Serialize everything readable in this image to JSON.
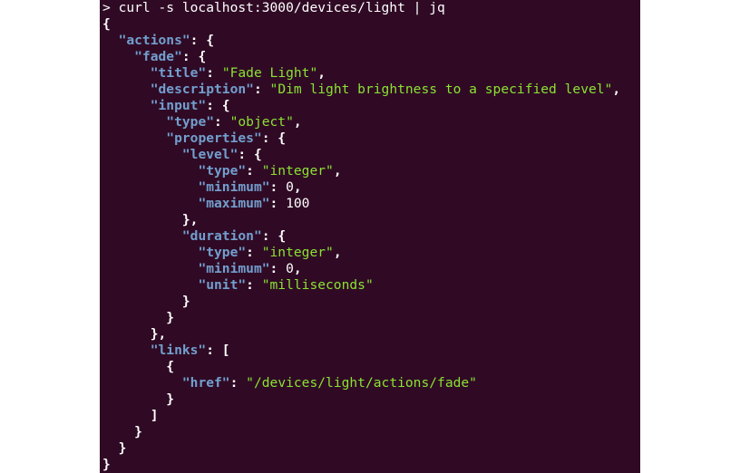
{
  "window": {
    "background": "#300a24"
  },
  "colors": {
    "key": "#729fcf",
    "string": "#8ae234",
    "text": "#ffffff"
  },
  "terminal": {
    "lines": [
      [
        {
          "t": "cmd",
          "v": "> curl -s localhost:3000/devices/light | jq"
        }
      ],
      [
        {
          "t": "punct",
          "v": "{"
        }
      ],
      [
        {
          "t": "punct",
          "v": "  "
        },
        {
          "t": "key",
          "v": "\"actions\""
        },
        {
          "t": "punct",
          "v": ": {"
        }
      ],
      [
        {
          "t": "punct",
          "v": "    "
        },
        {
          "t": "key",
          "v": "\"fade\""
        },
        {
          "t": "punct",
          "v": ": {"
        }
      ],
      [
        {
          "t": "punct",
          "v": "      "
        },
        {
          "t": "key",
          "v": "\"title\""
        },
        {
          "t": "punct",
          "v": ": "
        },
        {
          "t": "str",
          "v": "\"Fade Light\""
        },
        {
          "t": "punct",
          "v": ","
        }
      ],
      [
        {
          "t": "punct",
          "v": "      "
        },
        {
          "t": "key",
          "v": "\"description\""
        },
        {
          "t": "punct",
          "v": ": "
        },
        {
          "t": "str",
          "v": "\"Dim light brightness to a specified level\""
        },
        {
          "t": "punct",
          "v": ","
        }
      ],
      [
        {
          "t": "punct",
          "v": "      "
        },
        {
          "t": "key",
          "v": "\"input\""
        },
        {
          "t": "punct",
          "v": ": {"
        }
      ],
      [
        {
          "t": "punct",
          "v": "        "
        },
        {
          "t": "key",
          "v": "\"type\""
        },
        {
          "t": "punct",
          "v": ": "
        },
        {
          "t": "str",
          "v": "\"object\""
        },
        {
          "t": "punct",
          "v": ","
        }
      ],
      [
        {
          "t": "punct",
          "v": "        "
        },
        {
          "t": "key",
          "v": "\"properties\""
        },
        {
          "t": "punct",
          "v": ": {"
        }
      ],
      [
        {
          "t": "punct",
          "v": "          "
        },
        {
          "t": "key",
          "v": "\"level\""
        },
        {
          "t": "punct",
          "v": ": {"
        }
      ],
      [
        {
          "t": "punct",
          "v": "            "
        },
        {
          "t": "key",
          "v": "\"type\""
        },
        {
          "t": "punct",
          "v": ": "
        },
        {
          "t": "str",
          "v": "\"integer\""
        },
        {
          "t": "punct",
          "v": ","
        }
      ],
      [
        {
          "t": "punct",
          "v": "            "
        },
        {
          "t": "key",
          "v": "\"minimum\""
        },
        {
          "t": "punct",
          "v": ": "
        },
        {
          "t": "num",
          "v": "0"
        },
        {
          "t": "punct",
          "v": ","
        }
      ],
      [
        {
          "t": "punct",
          "v": "            "
        },
        {
          "t": "key",
          "v": "\"maximum\""
        },
        {
          "t": "punct",
          "v": ": "
        },
        {
          "t": "num",
          "v": "100"
        }
      ],
      [
        {
          "t": "punct",
          "v": "          },"
        }
      ],
      [
        {
          "t": "punct",
          "v": "          "
        },
        {
          "t": "key",
          "v": "\"duration\""
        },
        {
          "t": "punct",
          "v": ": {"
        }
      ],
      [
        {
          "t": "punct",
          "v": "            "
        },
        {
          "t": "key",
          "v": "\"type\""
        },
        {
          "t": "punct",
          "v": ": "
        },
        {
          "t": "str",
          "v": "\"integer\""
        },
        {
          "t": "punct",
          "v": ","
        }
      ],
      [
        {
          "t": "punct",
          "v": "            "
        },
        {
          "t": "key",
          "v": "\"minimum\""
        },
        {
          "t": "punct",
          "v": ": "
        },
        {
          "t": "num",
          "v": "0"
        },
        {
          "t": "punct",
          "v": ","
        }
      ],
      [
        {
          "t": "punct",
          "v": "            "
        },
        {
          "t": "key",
          "v": "\"unit\""
        },
        {
          "t": "punct",
          "v": ": "
        },
        {
          "t": "str",
          "v": "\"milliseconds\""
        }
      ],
      [
        {
          "t": "punct",
          "v": "          }"
        }
      ],
      [
        {
          "t": "punct",
          "v": "        }"
        }
      ],
      [
        {
          "t": "punct",
          "v": "      },"
        }
      ],
      [
        {
          "t": "punct",
          "v": "      "
        },
        {
          "t": "key",
          "v": "\"links\""
        },
        {
          "t": "punct",
          "v": ": ["
        }
      ],
      [
        {
          "t": "punct",
          "v": "        {"
        }
      ],
      [
        {
          "t": "punct",
          "v": "          "
        },
        {
          "t": "key",
          "v": "\"href\""
        },
        {
          "t": "punct",
          "v": ": "
        },
        {
          "t": "str",
          "v": "\"/devices/light/actions/fade\""
        }
      ],
      [
        {
          "t": "punct",
          "v": "        }"
        }
      ],
      [
        {
          "t": "punct",
          "v": "      ]"
        }
      ],
      [
        {
          "t": "punct",
          "v": "    }"
        }
      ],
      [
        {
          "t": "punct",
          "v": "  }"
        }
      ],
      [
        {
          "t": "punct",
          "v": "}"
        }
      ]
    ]
  }
}
